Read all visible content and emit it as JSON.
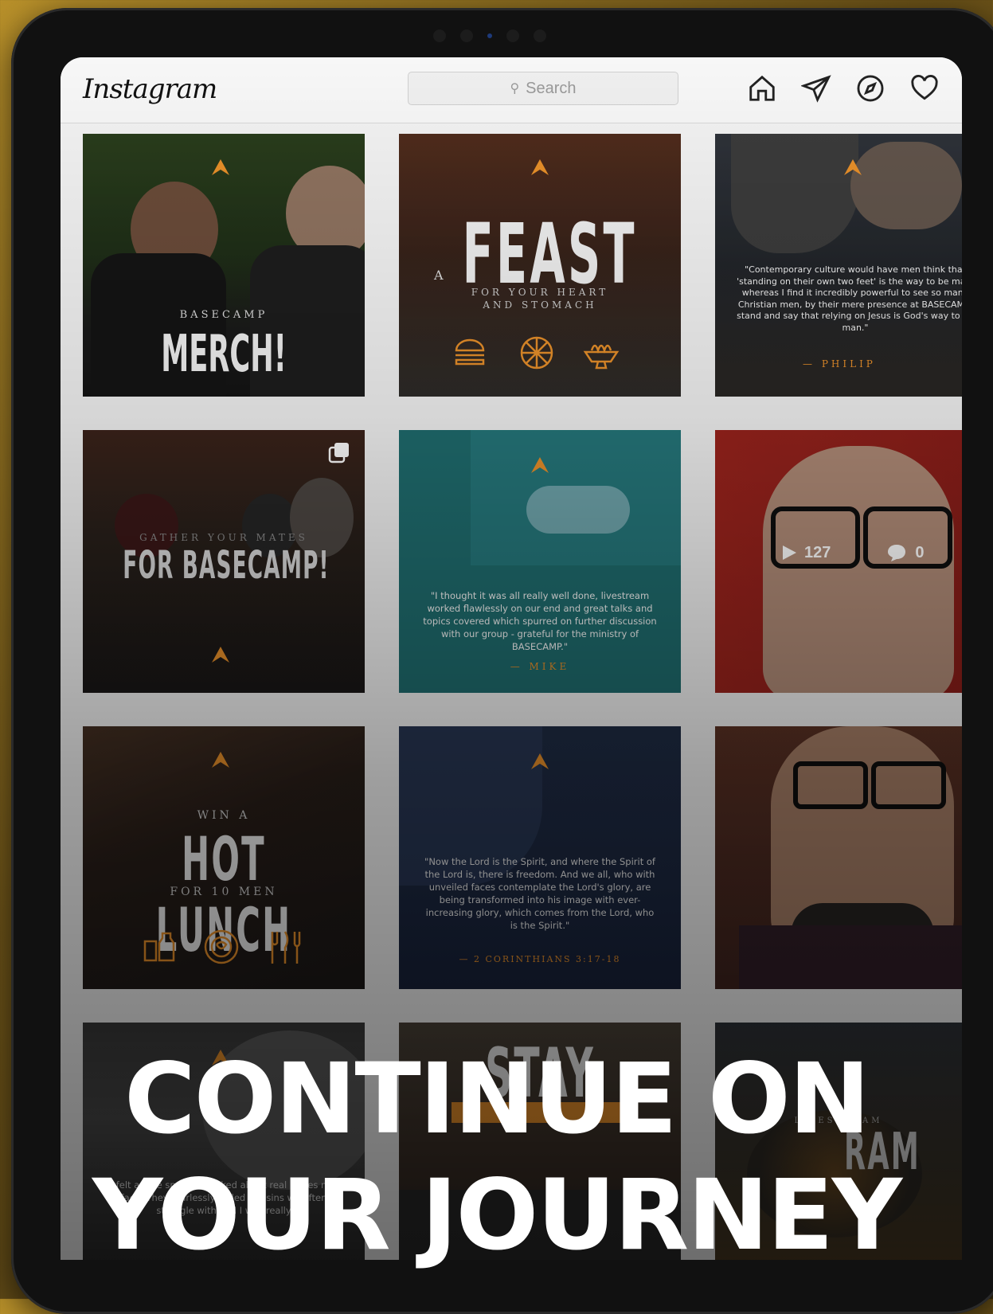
{
  "app": {
    "name": "Instagram"
  },
  "search": {
    "placeholder": "Search"
  },
  "nav": {
    "icons": [
      "home-icon",
      "direct-message-icon",
      "explore-icon",
      "activity-heart-icon"
    ]
  },
  "tiles": {
    "t1": {
      "line1": "BASECAMP",
      "line2": "MERCH!"
    },
    "t2": {
      "prefix": "A",
      "title": "FEAST",
      "sub1": "FOR YOUR HEART",
      "sub2": "AND STOMACH"
    },
    "t3": {
      "quote": "\"Contemporary culture would have men think that 'standing on their own two feet' is the way to be man, whereas I find it incredibly powerful to see so many Christian men, by their mere presence at BASECAMP, stand and say that relying on Jesus is God's way to be man.\"",
      "author": "— PHILIP"
    },
    "t4": {
      "line1": "GATHER YOUR MATES",
      "line2": "FOR BASECAMP!"
    },
    "t5": {
      "quote": "\"I thought it was all really well done, livestream worked flawlessly on our end and great talks and topics covered which spurred on further discussion with our group - grateful for the ministry of BASECAMP.\"",
      "author": "— MIKE"
    },
    "t6": {
      "views": "127",
      "comments": "0"
    },
    "t7": {
      "line1": "WIN A",
      "line2": "HOT LUNCH",
      "line3": "FOR 10 MEN"
    },
    "t8": {
      "quote": "\"Now the Lord is the Spirit, and where the Spirit of the Lord is, there is freedom. And we all, who with unveiled faces contemplate the Lord's glory, are being transformed into his image with ever-increasing glory, which comes from the Lord, who is the Spirit.\"",
      "author": "— 2 CORINTHIANS 3:17-18"
    },
    "t10": {
      "quote": "\"I felt as the speakers talked about real issues men face. They fearlessly called out sins we often struggle with and I was really"
    },
    "t11": {
      "line1": "STAY"
    },
    "t12": {
      "line1": "LIVESTREAM",
      "line2": "RAM"
    }
  },
  "overlay": {
    "line1": "CONTINUE ON",
    "line2": "YOUR JOURNEY"
  },
  "colors": {
    "accent": "#e8902a",
    "teal": "#1f6c6e",
    "red": "#b52a22"
  }
}
